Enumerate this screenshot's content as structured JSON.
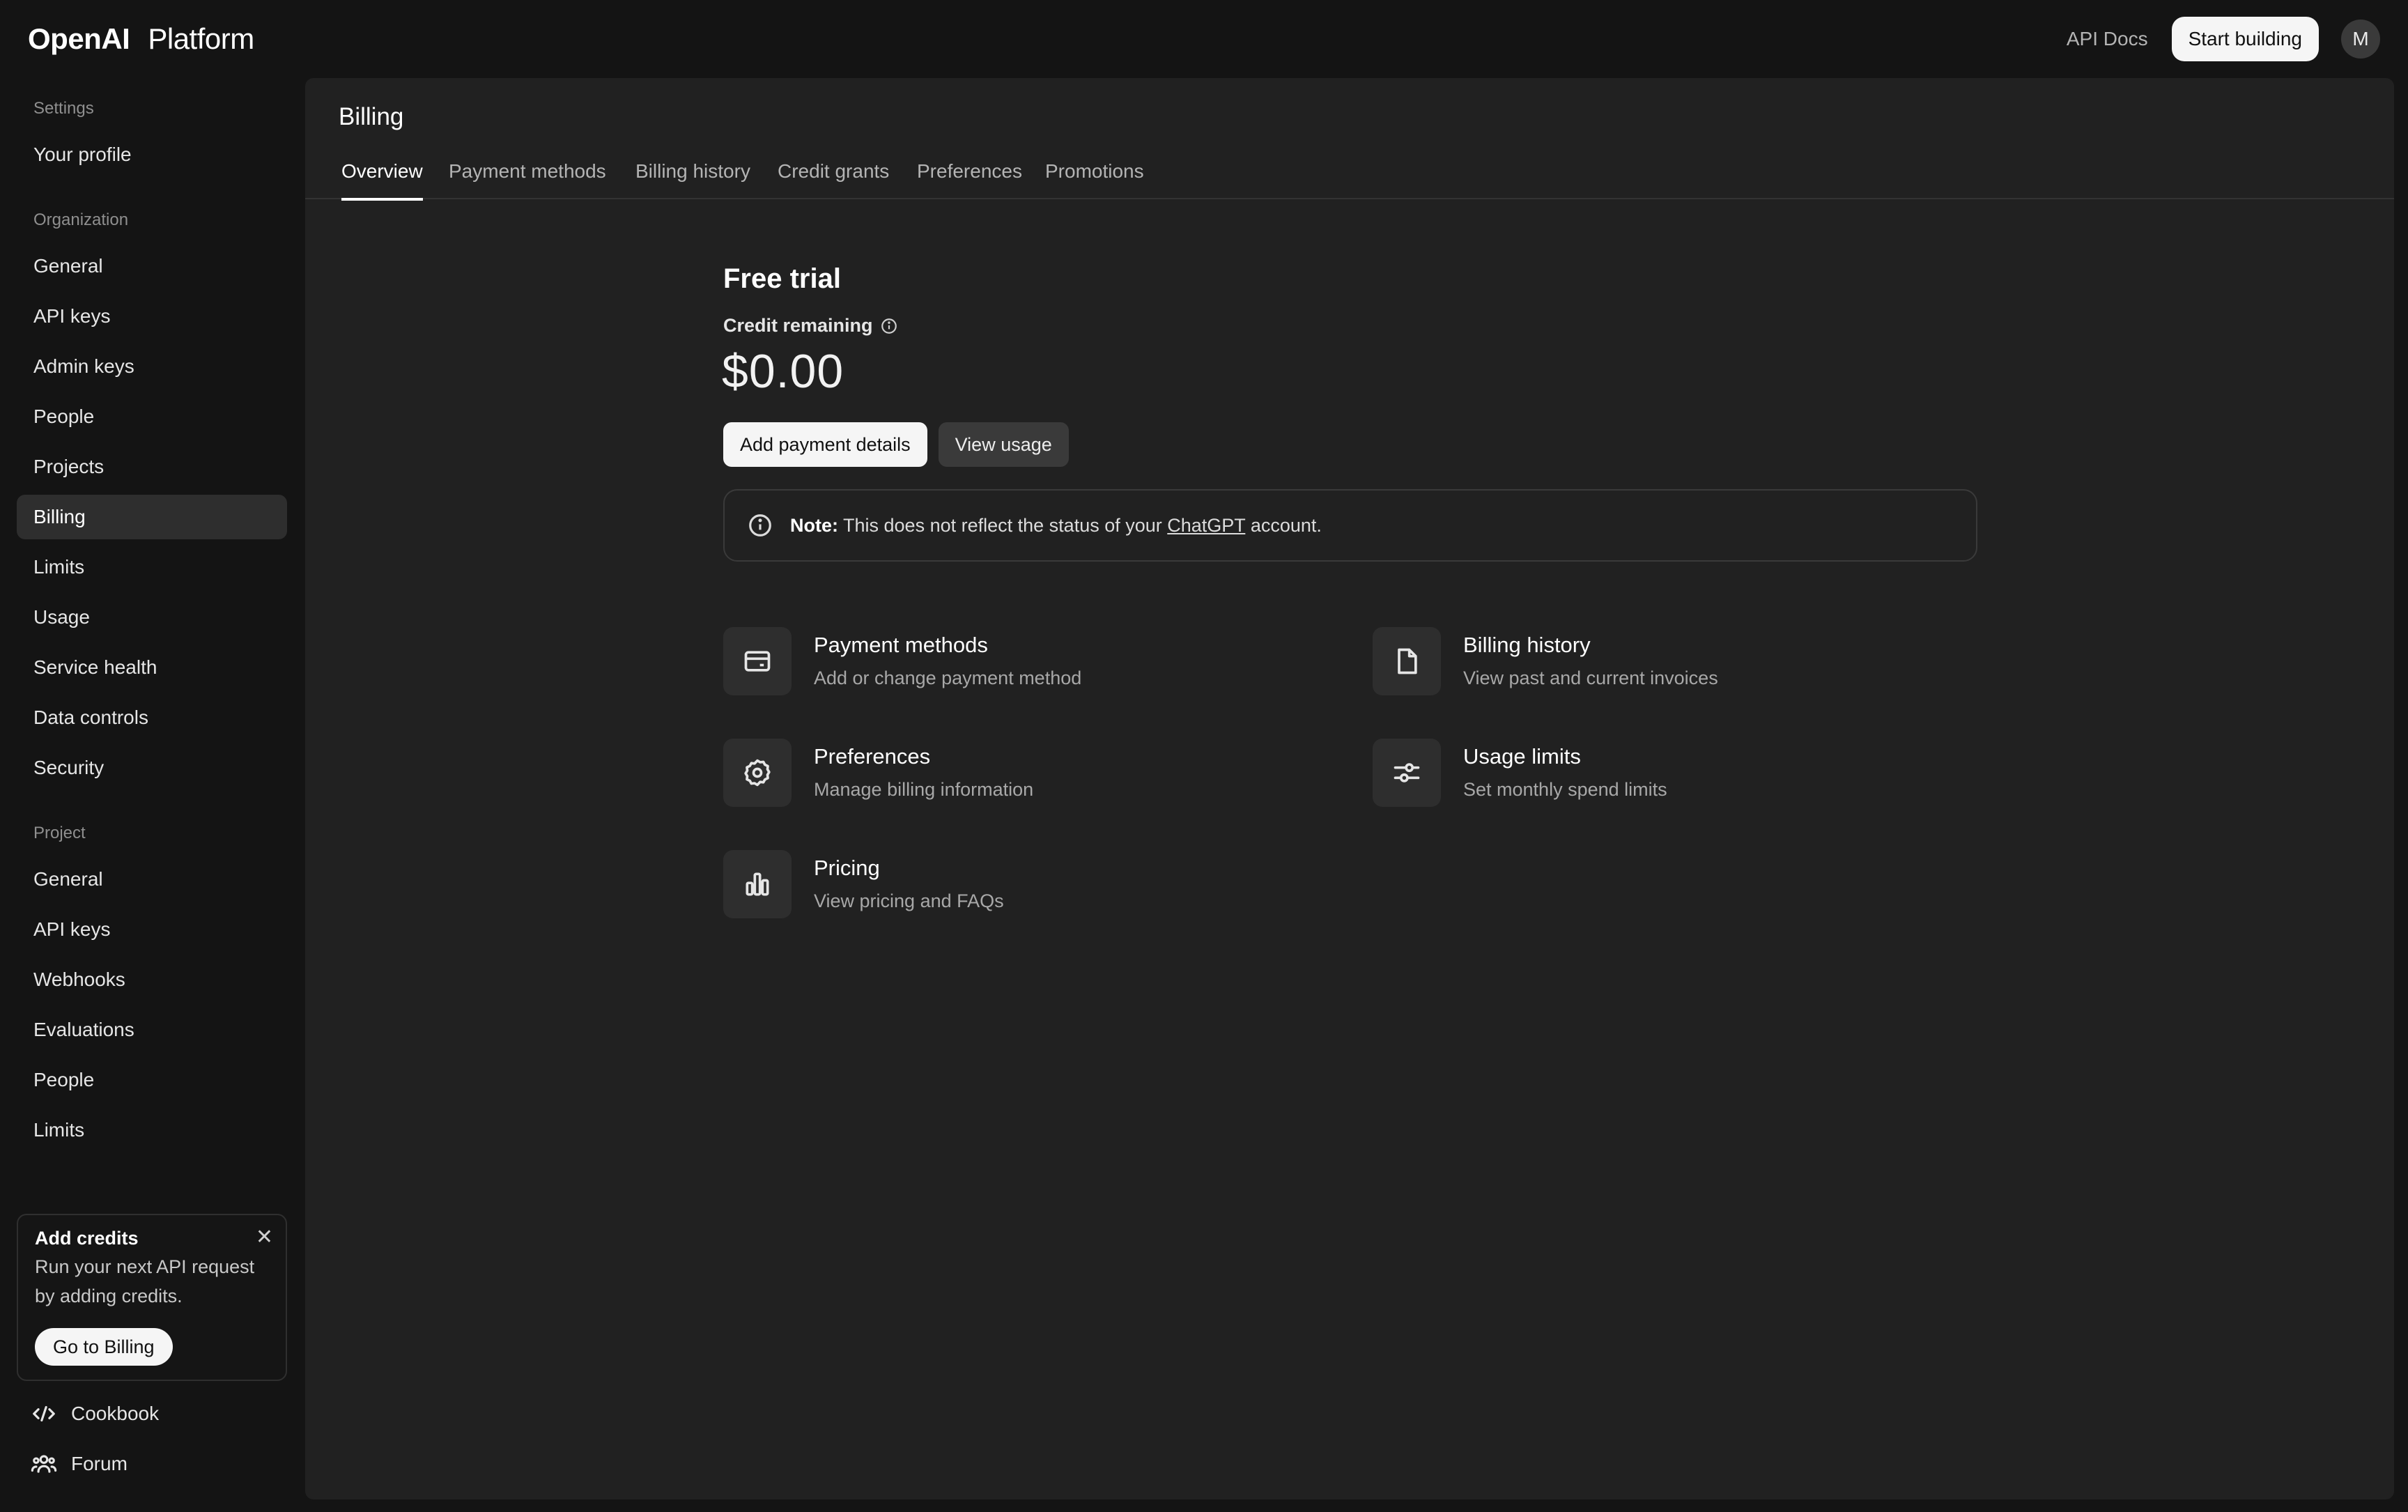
{
  "topbar": {
    "brand_name": "OpenAI",
    "brand_product": "Platform",
    "api_docs": "API Docs",
    "start_building": "Start building",
    "avatar_initial": "M"
  },
  "sidebar": {
    "settings_heading": "Settings",
    "your_profile": "Your profile",
    "organization_heading": "Organization",
    "org_items": [
      "General",
      "API keys",
      "Admin keys",
      "People",
      "Projects",
      "Billing",
      "Limits",
      "Usage",
      "Service health",
      "Data controls",
      "Security"
    ],
    "project_heading": "Project",
    "project_items": [
      "General",
      "API keys",
      "Webhooks",
      "Evaluations",
      "People",
      "Limits"
    ],
    "credits_card": {
      "title": "Add credits",
      "text": "Run your next API request by adding credits.",
      "button": "Go to Billing"
    },
    "cookbook": "Cookbook",
    "forum": "Forum"
  },
  "main": {
    "title": "Billing",
    "tabs": [
      "Overview",
      "Payment methods",
      "Billing history",
      "Credit grants",
      "Preferences",
      "Promotions"
    ],
    "plan": "Free trial",
    "credit_label": "Credit remaining",
    "credit_amount": "$0.00",
    "add_payment": "Add payment details",
    "view_usage": "View usage",
    "note": {
      "label": "Note:",
      "text_before": "This does not reflect the status of your",
      "link": "ChatGPT",
      "text_after": "account."
    },
    "cards": [
      {
        "title": "Payment methods",
        "subtitle": "Add or change payment method",
        "icon": "credit-card-icon"
      },
      {
        "title": "Billing history",
        "subtitle": "View past and current invoices",
        "icon": "document-icon"
      },
      {
        "title": "Preferences",
        "subtitle": "Manage billing information",
        "icon": "gear-icon"
      },
      {
        "title": "Usage limits",
        "subtitle": "Set monthly spend limits",
        "icon": "sliders-icon"
      },
      {
        "title": "Pricing",
        "subtitle": "View pricing and FAQs",
        "icon": "bar-chart-icon"
      }
    ]
  }
}
